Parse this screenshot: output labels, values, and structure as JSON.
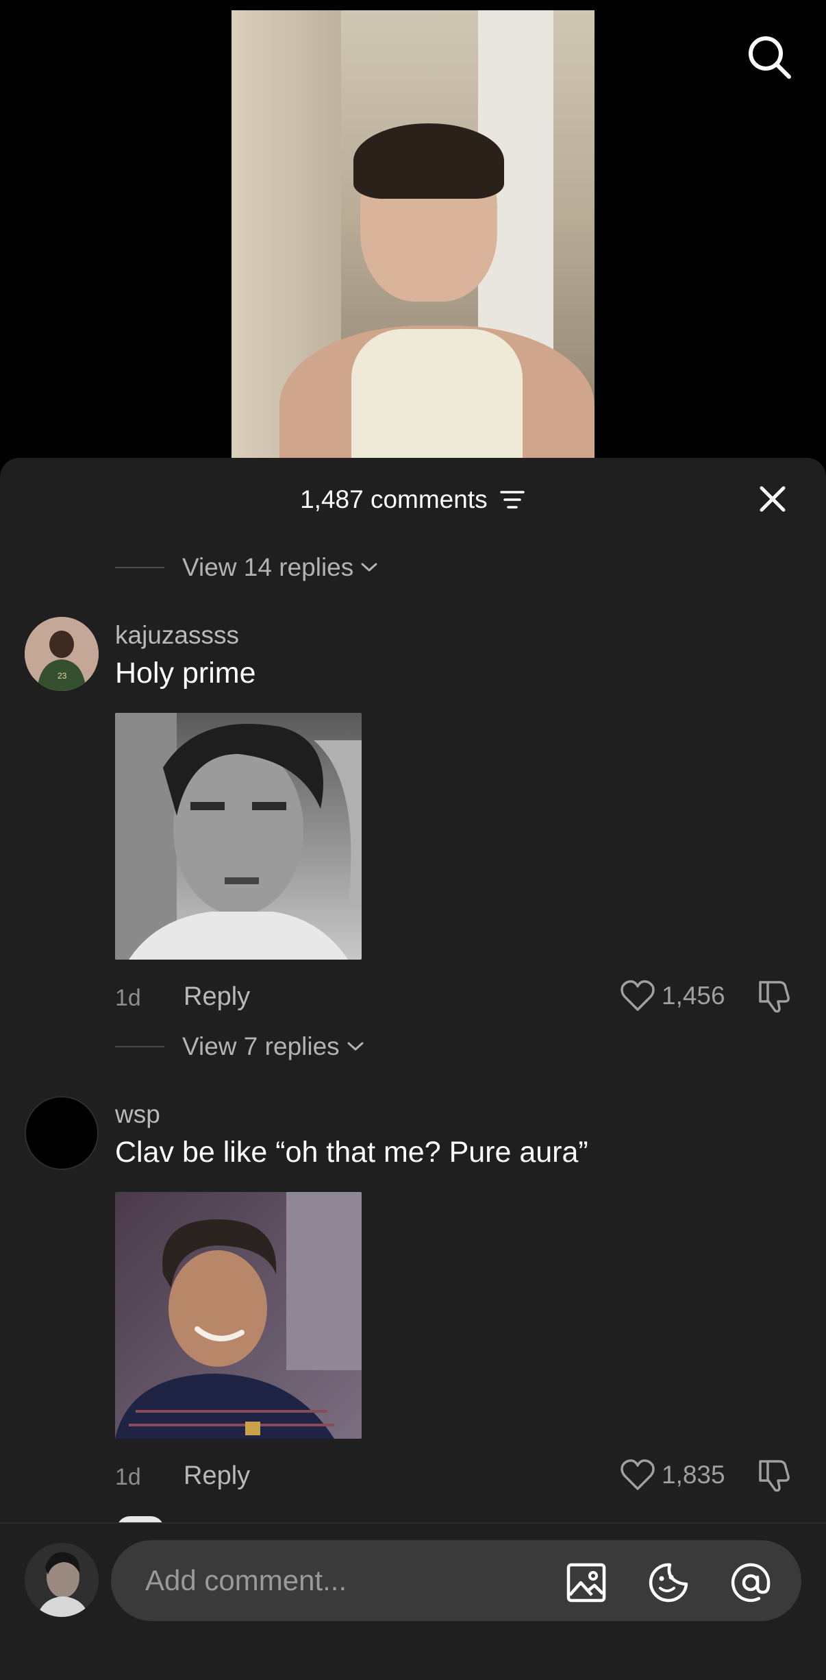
{
  "header": {
    "comments_count": "1,487 comments"
  },
  "threads": [
    {
      "view_replies": "View 14 replies"
    }
  ],
  "comments": [
    {
      "username": "kajuzassss",
      "text": "Holy prime",
      "time": "1d",
      "reply_label": "Reply",
      "likes": "1,456",
      "view_replies": "View 7 replies"
    },
    {
      "username": "wsp",
      "text": "Clav be like “oh that me? Pure aura”",
      "time": "1d",
      "reply_label": "Reply",
      "likes": "1,835"
    }
  ],
  "composer": {
    "placeholder": "Add comment..."
  },
  "icons": {
    "search": "search-icon",
    "close": "close-icon",
    "filter": "filter-icon",
    "heart": "heart-icon",
    "dislike": "dislike-icon",
    "image": "image-icon",
    "sticker": "sticker-icon",
    "mention": "at-mention-icon"
  },
  "colors": {
    "sheet_bg": "#1f1f20",
    "input_bg": "#3a3a3b",
    "muted_text": "#b3b3b3"
  }
}
